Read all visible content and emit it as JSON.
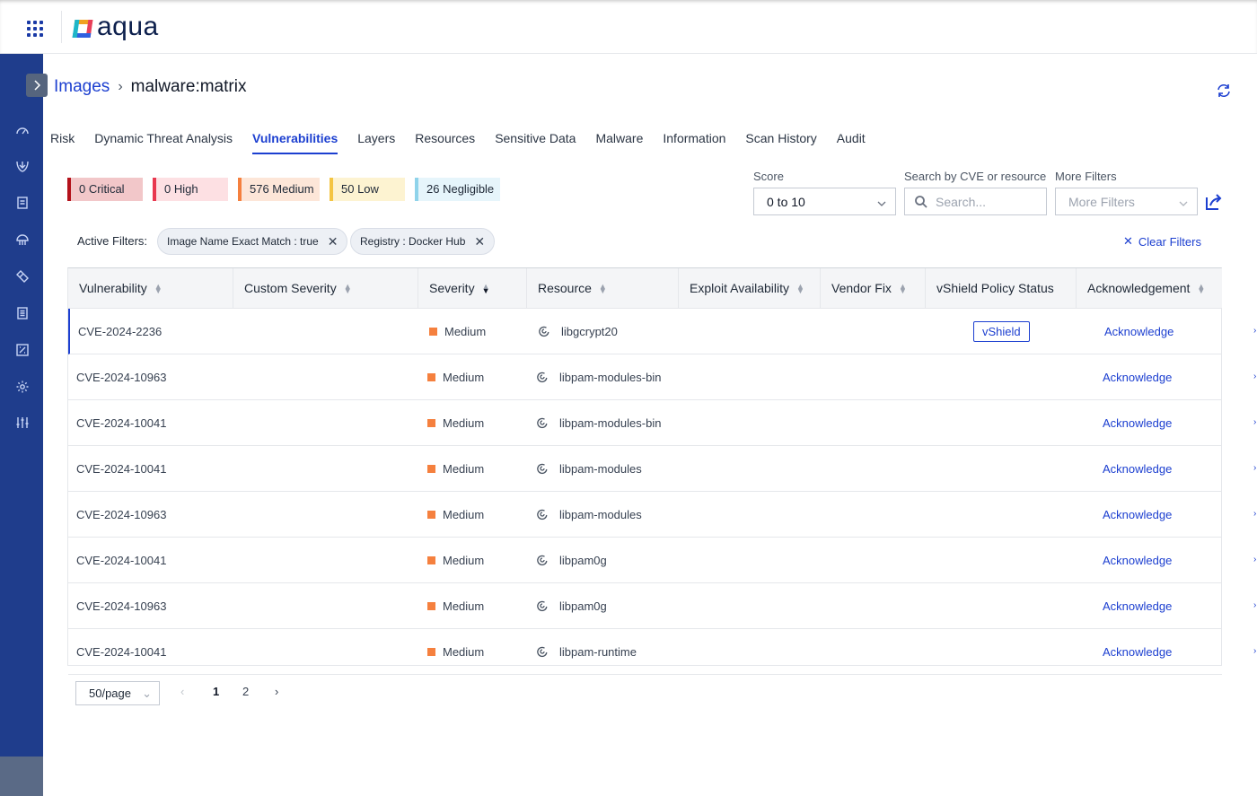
{
  "brand": {
    "logo_text": "aqua"
  },
  "breadcrumb": {
    "parent": "Images",
    "separator": "›",
    "current": "malware:matrix"
  },
  "tabs": [
    {
      "label": "Risk",
      "active": false
    },
    {
      "label": "Dynamic Threat Analysis",
      "active": false
    },
    {
      "label": "Vulnerabilities",
      "active": true
    },
    {
      "label": "Layers",
      "active": false
    },
    {
      "label": "Resources",
      "active": false
    },
    {
      "label": "Sensitive Data",
      "active": false
    },
    {
      "label": "Malware",
      "active": false
    },
    {
      "label": "Information",
      "active": false
    },
    {
      "label": "Scan History",
      "active": false
    },
    {
      "label": "Audit",
      "active": false
    }
  ],
  "severity_summary": [
    {
      "label": "0 Critical",
      "count": 0,
      "color": "#b4121b",
      "bg": "#f2c7c9"
    },
    {
      "label": "0 High",
      "count": 0,
      "color": "#e8384f",
      "bg": "#fde0e3"
    },
    {
      "label": "576 Medium",
      "count": 576,
      "color": "#f5803e",
      "bg": "#fde6d8"
    },
    {
      "label": "50 Low",
      "count": 50,
      "color": "#f4c542",
      "bg": "#fdf3d1"
    },
    {
      "label": "26 Negligible",
      "count": 26,
      "color": "#8fd3ea",
      "bg": "#e6f5fb"
    }
  ],
  "filters": {
    "score": {
      "label": "Score",
      "value": "0 to 10"
    },
    "search": {
      "label": "Search by CVE or resource",
      "placeholder": "Search..."
    },
    "more": {
      "label": "More Filters",
      "placeholder": "More Filters"
    }
  },
  "active_filters": {
    "label": "Active Filters:",
    "chips": [
      "Image Name Exact Match : true",
      "Registry : Docker Hub"
    ],
    "clear_label": "Clear Filters"
  },
  "table": {
    "columns": [
      "Vulnerability",
      "Custom Severity",
      "Severity",
      "Resource",
      "Exploit Availability",
      "Vendor Fix",
      "vShield Policy Status",
      "Acknowledgement"
    ],
    "rows": [
      {
        "cve": "CVE-2024-2236",
        "severity": "Medium",
        "resource": "libgcrypt20",
        "vshield": "vShield",
        "ack": "Acknowledge"
      },
      {
        "cve": "CVE-2024-10963",
        "severity": "Medium",
        "resource": "libpam-modules-bin",
        "vshield": "",
        "ack": "Acknowledge"
      },
      {
        "cve": "CVE-2024-10041",
        "severity": "Medium",
        "resource": "libpam-modules-bin",
        "vshield": "",
        "ack": "Acknowledge"
      },
      {
        "cve": "CVE-2024-10041",
        "severity": "Medium",
        "resource": "libpam-modules",
        "vshield": "",
        "ack": "Acknowledge"
      },
      {
        "cve": "CVE-2024-10963",
        "severity": "Medium",
        "resource": "libpam-modules",
        "vshield": "",
        "ack": "Acknowledge"
      },
      {
        "cve": "CVE-2024-10041",
        "severity": "Medium",
        "resource": "libpam0g",
        "vshield": "",
        "ack": "Acknowledge"
      },
      {
        "cve": "CVE-2024-10963",
        "severity": "Medium",
        "resource": "libpam0g",
        "vshield": "",
        "ack": "Acknowledge"
      },
      {
        "cve": "CVE-2024-10041",
        "severity": "Medium",
        "resource": "libpam-runtime",
        "vshield": "",
        "ack": "Acknowledge"
      }
    ]
  },
  "pagination": {
    "page_size": "50/page",
    "pages": [
      "1",
      "2"
    ],
    "current": "1"
  },
  "colors": {
    "accent": "#1c3fd0",
    "sidebar": "#1f3d8c",
    "medium": "#f5803e"
  },
  "icons": {
    "sidebar": [
      "dashboard-icon",
      "shield-download-icon",
      "document-icon",
      "umbrella-icon",
      "tag-icon",
      "list-document-icon",
      "chart-box-icon",
      "settings-icon",
      "sliders-icon"
    ]
  }
}
